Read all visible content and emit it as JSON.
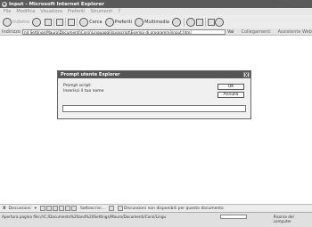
{
  "window": {
    "title": "Input - Microsoft Internet Explorer"
  },
  "menubar": {
    "items": [
      "File",
      "Modifica",
      "Visualizza",
      "Preferiti",
      "Strumenti",
      "?"
    ]
  },
  "toolbar": {
    "back_label": "Indietro",
    "search_label": "Cerca",
    "favorites_label": "Preferiti",
    "media_label": "Multimedia"
  },
  "addressbar": {
    "label": "Indirizzo",
    "url": "nd Settings\\Mauro\\Documenti\\Corsi\\Linguaggi\\Javascript\\Esempi di programmi\\input.html",
    "go_label": "Vai",
    "links_label": "Collegamenti",
    "assistant_label": "Assistente Web"
  },
  "dialog": {
    "title": "Prompt utente Explorer",
    "close_label": "X",
    "prompt_line1": "Prompt script:",
    "prompt_line2": "Inserisci il tuo nome",
    "ok_label": "OK",
    "cancel_label": "Annulla",
    "input_value": ""
  },
  "discussionbar": {
    "close_label": "X",
    "label": "Discussioni",
    "subscribe_label": "Sottoscrivi...",
    "message": "Discussioni non disponibili per questo documento"
  },
  "statusbar": {
    "text": "Apertura pagina file:///C:/Documents%20and%20Settings/Mauro/Documenti/Corsi/Lingu",
    "zone": "Risorse del computer"
  }
}
